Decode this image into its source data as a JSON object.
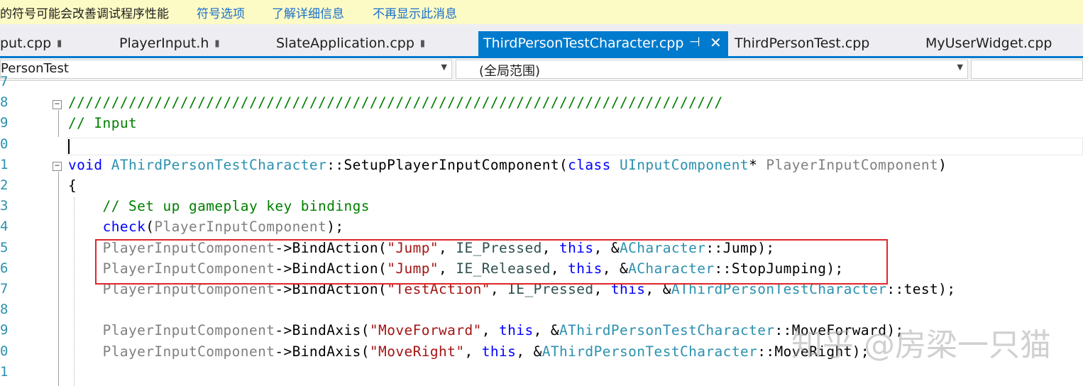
{
  "infobar": {
    "message": "的符号可能会改善调试程序性能",
    "links": [
      "符号选项",
      "了解详细信息",
      "不再显示此消息"
    ]
  },
  "tabs": [
    {
      "label": "put.cpp",
      "locked": true
    },
    {
      "label": "PlayerInput.h",
      "locked": true
    },
    {
      "label": "SlateApplication.cpp",
      "locked": true
    },
    {
      "label": "ThirdPersonTestCharacter.cpp",
      "active": true
    },
    {
      "label": "ThirdPersonTest.cpp"
    },
    {
      "label": "MyUserWidget.cpp"
    }
  ],
  "tab_icons": {
    "pin": "⊣",
    "close": "✕",
    "lock": "▮"
  },
  "nav": {
    "project": "PersonTest",
    "scope": "(全局范围)"
  },
  "editor": {
    "line_numbers": [
      "7",
      "8",
      "9",
      "0",
      "1",
      "2",
      "3",
      "4",
      "5",
      "6",
      "7",
      "8",
      "9",
      "0",
      "1"
    ],
    "lines": [
      {
        "tokens": [
          {
            "t": "",
            "c": ""
          }
        ]
      },
      {
        "tokens": [
          {
            "t": "////////////////////////////////////////////////////////////////////////////",
            "c": "cmt"
          }
        ]
      },
      {
        "tokens": [
          {
            "t": "// Input",
            "c": "cmt"
          }
        ]
      },
      {
        "tokens": [
          {
            "t": "",
            "c": ""
          }
        ]
      },
      {
        "tokens": [
          {
            "t": "void",
            "c": "kw"
          },
          {
            "t": " ",
            "c": ""
          },
          {
            "t": "AThirdPersonTestCharacter",
            "c": "cls"
          },
          {
            "t": "::SetupPlayerInputComponent(",
            "c": ""
          },
          {
            "t": "class",
            "c": "kw"
          },
          {
            "t": " ",
            "c": ""
          },
          {
            "t": "UInputComponent",
            "c": "cls"
          },
          {
            "t": "* ",
            "c": ""
          },
          {
            "t": "PlayerInputComponent",
            "c": "prm"
          },
          {
            "t": ")",
            "c": ""
          }
        ]
      },
      {
        "tokens": [
          {
            "t": "{",
            "c": ""
          }
        ]
      },
      {
        "tokens": [
          {
            "t": "    // Set up gameplay key bindings",
            "c": "cmt"
          }
        ]
      },
      {
        "tokens": [
          {
            "t": "    ",
            "c": ""
          },
          {
            "t": "check",
            "c": "kw"
          },
          {
            "t": "(",
            "c": ""
          },
          {
            "t": "PlayerInputComponent",
            "c": "prm"
          },
          {
            "t": ");",
            "c": ""
          }
        ]
      },
      {
        "tokens": [
          {
            "t": "    ",
            "c": ""
          },
          {
            "t": "PlayerInputComponent",
            "c": "prm"
          },
          {
            "t": "->BindAction(",
            "c": ""
          },
          {
            "t": "\"Jump\"",
            "c": "str"
          },
          {
            "t": ", ",
            "c": ""
          },
          {
            "t": "IE_Pressed",
            "c": "enm"
          },
          {
            "t": ", ",
            "c": ""
          },
          {
            "t": "this",
            "c": "kw"
          },
          {
            "t": ", &",
            "c": ""
          },
          {
            "t": "ACharacter",
            "c": "cls"
          },
          {
            "t": "::Jump);",
            "c": ""
          }
        ]
      },
      {
        "tokens": [
          {
            "t": "    ",
            "c": ""
          },
          {
            "t": "PlayerInputComponent",
            "c": "prm"
          },
          {
            "t": "->BindAction(",
            "c": ""
          },
          {
            "t": "\"Jump\"",
            "c": "str"
          },
          {
            "t": ", ",
            "c": ""
          },
          {
            "t": "IE_Released",
            "c": "enm"
          },
          {
            "t": ", ",
            "c": ""
          },
          {
            "t": "this",
            "c": "kw"
          },
          {
            "t": ", &",
            "c": ""
          },
          {
            "t": "ACharacter",
            "c": "cls"
          },
          {
            "t": "::StopJumping);",
            "c": ""
          }
        ]
      },
      {
        "tokens": [
          {
            "t": "    ",
            "c": ""
          },
          {
            "t": "PlayerInputComponent",
            "c": "prm"
          },
          {
            "t": "->BindAction(",
            "c": ""
          },
          {
            "t": "\"TestAction\"",
            "c": "str"
          },
          {
            "t": ", ",
            "c": ""
          },
          {
            "t": "IE_Pressed",
            "c": "enm"
          },
          {
            "t": ", ",
            "c": ""
          },
          {
            "t": "this",
            "c": "kw"
          },
          {
            "t": ", &",
            "c": ""
          },
          {
            "t": "AThirdPersonTestCharacter",
            "c": "cls"
          },
          {
            "t": "::test);",
            "c": ""
          }
        ]
      },
      {
        "tokens": [
          {
            "t": "",
            "c": ""
          }
        ]
      },
      {
        "tokens": [
          {
            "t": "    ",
            "c": ""
          },
          {
            "t": "PlayerInputComponent",
            "c": "prm"
          },
          {
            "t": "->BindAxis(",
            "c": ""
          },
          {
            "t": "\"MoveForward\"",
            "c": "str"
          },
          {
            "t": ", ",
            "c": ""
          },
          {
            "t": "this",
            "c": "kw"
          },
          {
            "t": ", &",
            "c": ""
          },
          {
            "t": "AThirdPersonTestCharacter",
            "c": "cls"
          },
          {
            "t": "::MoveForward);",
            "c": ""
          }
        ]
      },
      {
        "tokens": [
          {
            "t": "    ",
            "c": ""
          },
          {
            "t": "PlayerInputComponent",
            "c": "prm"
          },
          {
            "t": "->BindAxis(",
            "c": ""
          },
          {
            "t": "\"MoveRight\"",
            "c": "str"
          },
          {
            "t": ", ",
            "c": ""
          },
          {
            "t": "this",
            "c": "kw"
          },
          {
            "t": ", &",
            "c": ""
          },
          {
            "t": "AThirdPersonTestCharacter",
            "c": "cls"
          },
          {
            "t": "::MoveRight);",
            "c": ""
          }
        ]
      },
      {
        "tokens": [
          {
            "t": "",
            "c": ""
          }
        ]
      }
    ]
  },
  "watermark": "知乎 @房梁一只猫",
  "colors": {
    "keyword": "#0000ff",
    "type": "#2b91af",
    "comment": "#008000",
    "string": "#a31515",
    "parameter": "#808080",
    "active_tab": "#007acc",
    "highlight_box": "#e0262b",
    "infobar": "#fdfbc5"
  }
}
